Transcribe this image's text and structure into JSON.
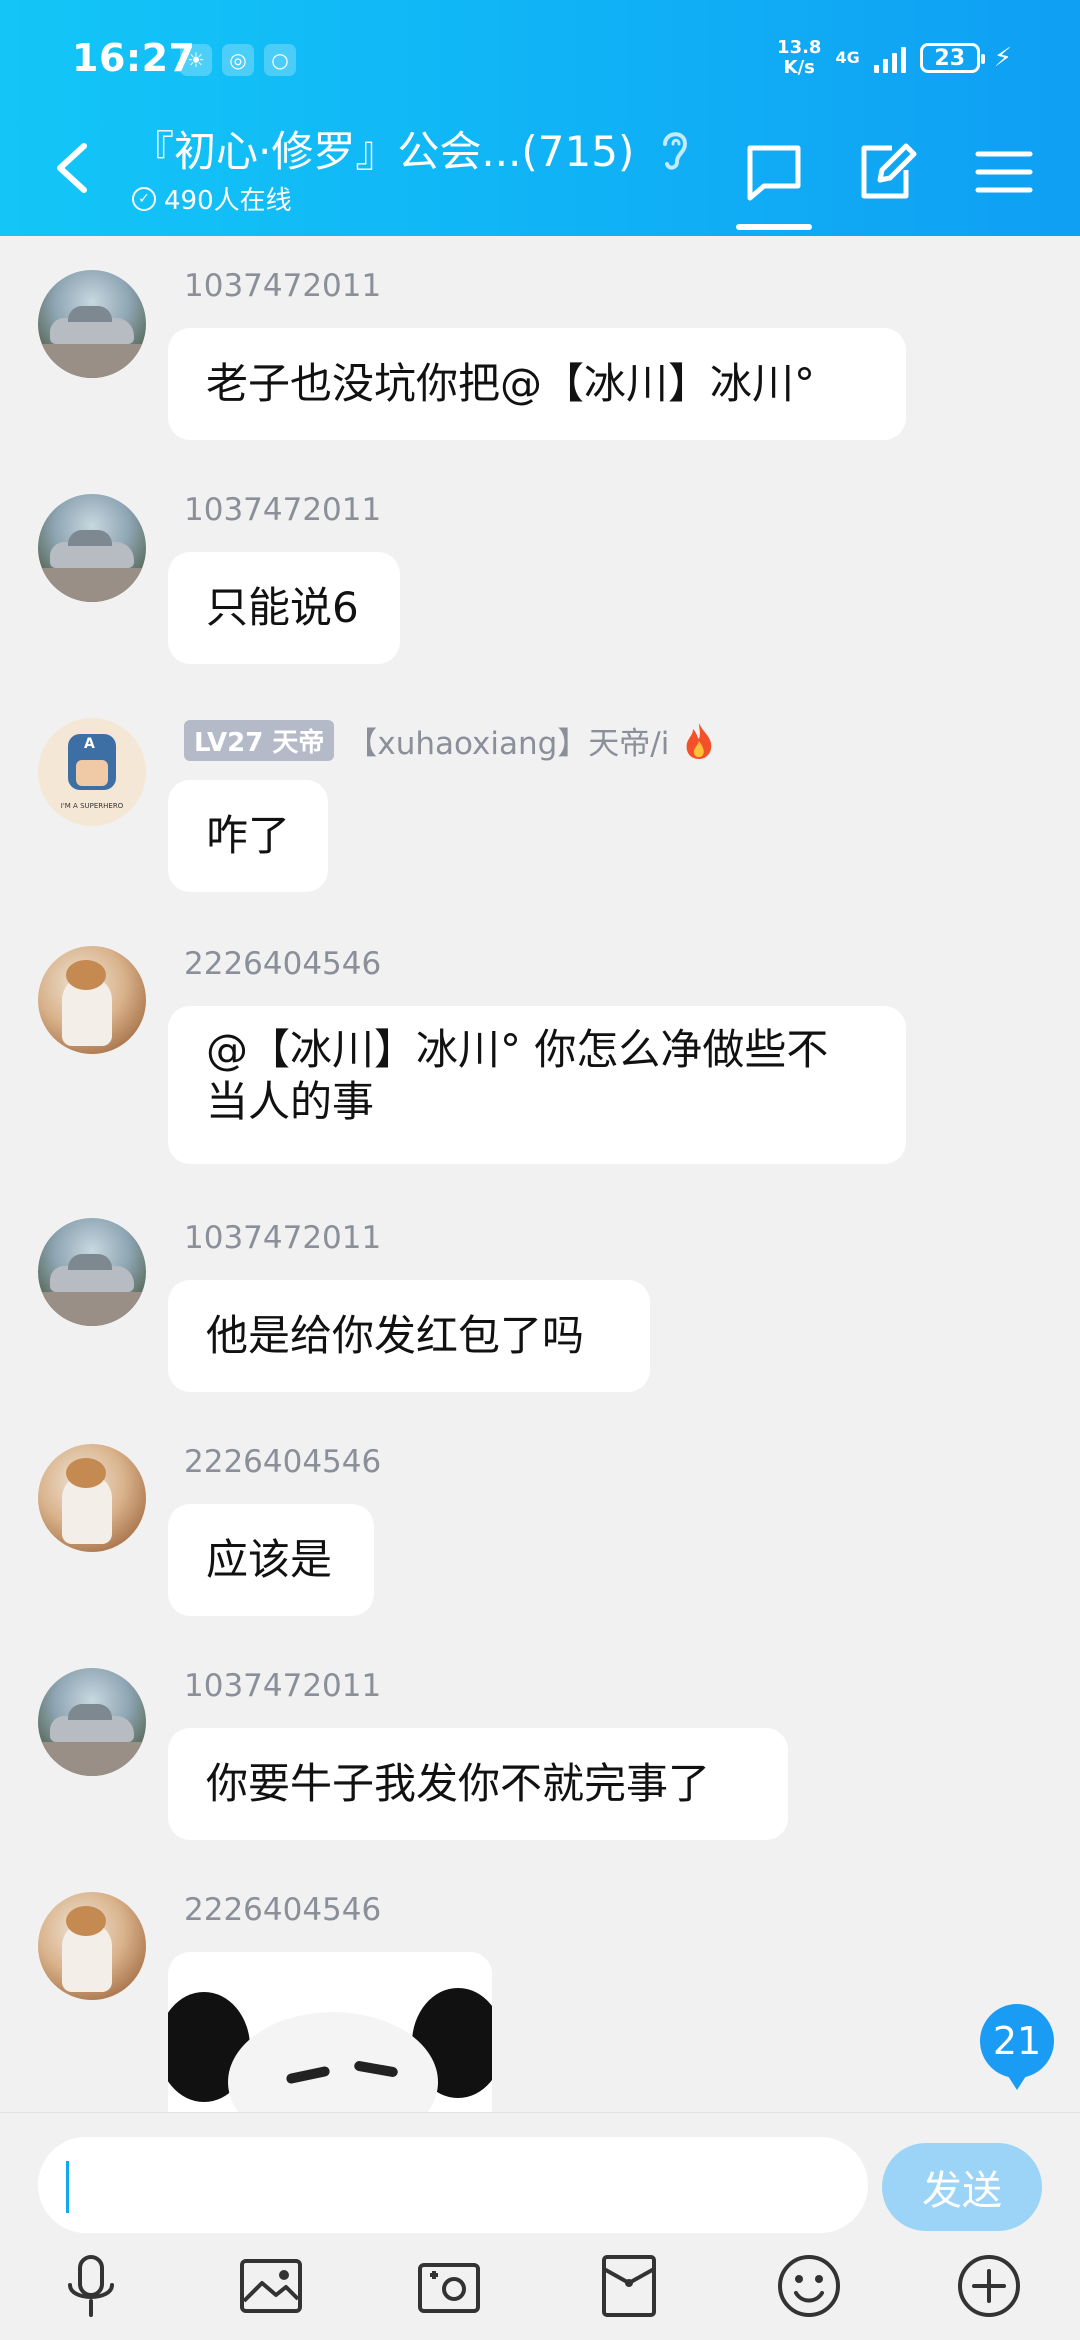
{
  "status_bar": {
    "time": "16:27",
    "net_speed_value": "13.8",
    "net_speed_unit": "K/s",
    "net_type": "4G",
    "battery": "23"
  },
  "header": {
    "title": "『初心·修罗』公会...(715)",
    "online": "490人在线"
  },
  "messages": [
    {
      "sender": "1037472011",
      "text": "老子也没坑你把@【冰川】冰川°",
      "avatar": "car"
    },
    {
      "sender": "1037472011",
      "text": "只能说6",
      "avatar": "car"
    },
    {
      "badge": "LV27 天帝",
      "sender": "【xuhaoxiang】天帝/i",
      "text": "咋了",
      "avatar": "captain"
    },
    {
      "sender": "2226404546",
      "text_line1": "@【冰川】冰川° 你怎么净做些不",
      "text_line2": "当人的事",
      "avatar": "cat"
    },
    {
      "sender": "1037472011",
      "text": "他是给你发红包了吗",
      "avatar": "car"
    },
    {
      "sender": "2226404546",
      "text": "应该是",
      "avatar": "cat"
    },
    {
      "sender": "1037472011",
      "text": "你要牛子我发你不就完事了",
      "avatar": "car"
    },
    {
      "sender": "2226404546",
      "avatar": "cat",
      "content": "panda-meme-image"
    }
  ],
  "unread_count": "21",
  "input": {
    "placeholder": "",
    "send_label": "发送"
  },
  "toolbar_icons": [
    "microphone-icon",
    "photo-icon",
    "camera-icon",
    "red-packet-icon",
    "emoji-icon",
    "plus-icon"
  ],
  "colors": {
    "header_start": "#13c6f7",
    "header_end": "#0f9ff3",
    "send_button": "#9bd4f7",
    "badge": "#1a9cf4"
  }
}
